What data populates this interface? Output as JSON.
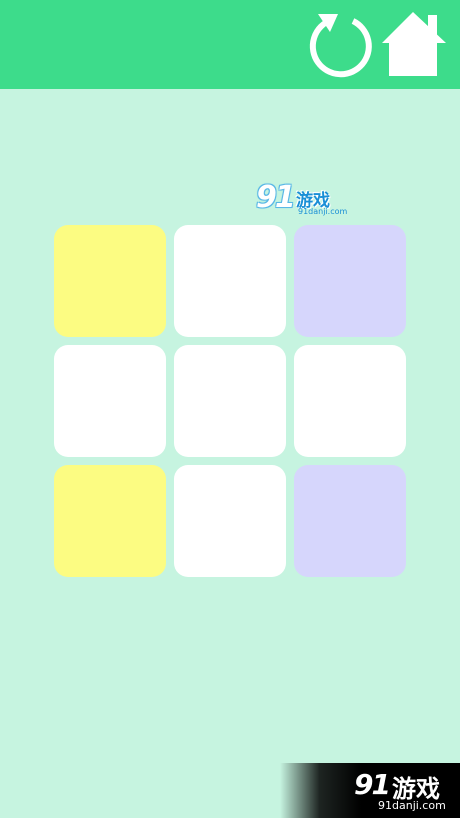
{
  "colors": {
    "background": "#c6f4e0",
    "topbar": "#3ddc8b",
    "icon": "#ffffff",
    "tile_yellow": "#fcfc82",
    "tile_white": "#ffffff",
    "tile_lavender": "#d6d6fc"
  },
  "toolbar": {
    "restart_icon": "restart-icon",
    "home_icon": "home-icon"
  },
  "board": {
    "rows": 3,
    "cols": 3,
    "tiles": [
      {
        "row": 0,
        "col": 0,
        "color": "yellow"
      },
      {
        "row": 0,
        "col": 1,
        "color": "white"
      },
      {
        "row": 0,
        "col": 2,
        "color": "lavender"
      },
      {
        "row": 1,
        "col": 0,
        "color": "white"
      },
      {
        "row": 1,
        "col": 1,
        "color": "white"
      },
      {
        "row": 1,
        "col": 2,
        "color": "white"
      },
      {
        "row": 2,
        "col": 0,
        "color": "yellow"
      },
      {
        "row": 2,
        "col": 1,
        "color": "white"
      },
      {
        "row": 2,
        "col": 2,
        "color": "lavender"
      }
    ]
  },
  "watermark_top": {
    "logo": "91",
    "name": "游戏",
    "url": "91danji.com"
  },
  "watermark_bottom": {
    "logo": "91",
    "name": "游戏",
    "url": "91danji.com"
  }
}
